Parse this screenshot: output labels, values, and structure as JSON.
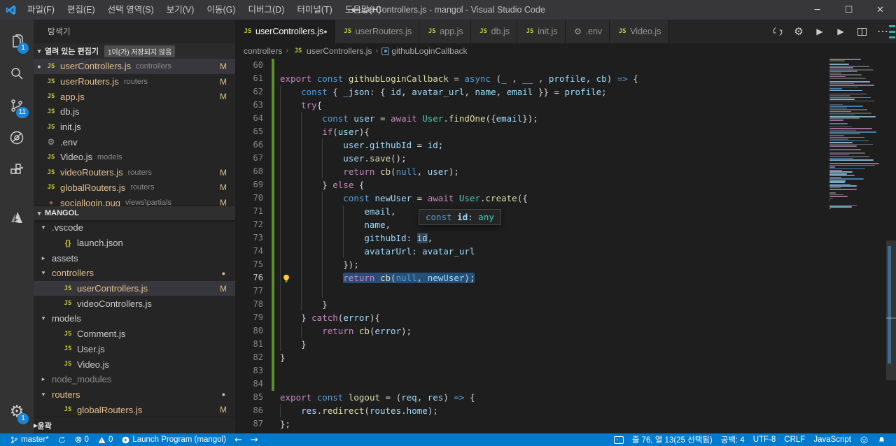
{
  "window": {
    "title": "● userControllers.js - mangol - Visual Studio Code",
    "controls": [
      {
        "name": "minimize",
        "glyph": "─"
      },
      {
        "name": "maximize",
        "glyph": "☐"
      },
      {
        "name": "close",
        "glyph": "✕"
      }
    ]
  },
  "menus": [
    "파일(F)",
    "편집(E)",
    "선택 영역(S)",
    "보기(V)",
    "이동(G)",
    "디버그(D)",
    "터미널(T)",
    "도움말(H)"
  ],
  "activity_bar": {
    "items": [
      {
        "name": "explorer",
        "badge": "1"
      },
      {
        "name": "search",
        "badge": ""
      },
      {
        "name": "source-control",
        "badge": "11"
      },
      {
        "name": "debug",
        "badge": ""
      },
      {
        "name": "extensions",
        "badge": ""
      },
      {
        "name": "azure",
        "badge": "",
        "spaced": true
      }
    ],
    "bottom": {
      "name": "settings-gear",
      "badge": "1"
    }
  },
  "sidebar": {
    "title": "탐색기",
    "open_editors": {
      "label": "열려 있는 편집기",
      "badge": "1이(가) 저장되지 않음",
      "items": [
        {
          "icon": "js",
          "label": "userControllers.js",
          "desc": "controllers",
          "m": true,
          "dirty": true,
          "selected": true,
          "gold": true
        },
        {
          "icon": "js",
          "label": "userRouters.js",
          "desc": "routers",
          "m": true,
          "gold": true
        },
        {
          "icon": "js",
          "label": "app.js",
          "desc": "",
          "m": true,
          "gold": true
        },
        {
          "icon": "js",
          "label": "db.js",
          "desc": "",
          "m": false
        },
        {
          "icon": "js",
          "label": "init.js",
          "desc": "",
          "m": false
        },
        {
          "icon": "gear",
          "label": ".env",
          "desc": "",
          "m": false
        },
        {
          "icon": "js",
          "label": "Video.js",
          "desc": "models",
          "m": false
        },
        {
          "icon": "js",
          "label": "videoRouters.js",
          "desc": "routers",
          "m": true,
          "gold": true
        },
        {
          "icon": "js",
          "label": "globalRouters.js",
          "desc": "routers",
          "m": true,
          "gold": true
        },
        {
          "icon": "pug",
          "label": "sociallogin.pug",
          "desc": "views\\partials",
          "m": true,
          "gold": true
        }
      ]
    },
    "project": {
      "label": "MANGOL",
      "items": [
        {
          "type": "folder",
          "label": ".vscode",
          "expanded": true,
          "level": 0
        },
        {
          "type": "file",
          "icon": "braces",
          "label": "launch.json",
          "level": 1
        },
        {
          "type": "folder",
          "label": "assets",
          "expanded": false,
          "level": 0
        },
        {
          "type": "folder",
          "label": "controllers",
          "expanded": true,
          "level": 0,
          "gold": true,
          "dot": true
        },
        {
          "type": "file",
          "icon": "js",
          "label": "userControllers.js",
          "level": 1,
          "gold": true,
          "m": true,
          "selected": true
        },
        {
          "type": "file",
          "icon": "js",
          "label": "videoControllers.js",
          "level": 1
        },
        {
          "type": "folder",
          "label": "models",
          "expanded": true,
          "level": 0
        },
        {
          "type": "file",
          "icon": "js",
          "label": "Comment.js",
          "level": 1
        },
        {
          "type": "file",
          "icon": "js",
          "label": "User.js",
          "level": 1
        },
        {
          "type": "file",
          "icon": "js",
          "label": "Video.js",
          "level": 1
        },
        {
          "type": "folder",
          "label": "node_modules",
          "expanded": false,
          "level": 0,
          "dim": true
        },
        {
          "type": "folder",
          "label": "routers",
          "expanded": true,
          "level": 0,
          "gold": true,
          "dot": true
        },
        {
          "type": "file",
          "icon": "js",
          "label": "globalRouters.js",
          "level": 1,
          "gold": true,
          "m": true
        }
      ]
    },
    "outline": {
      "label": "윤곽"
    }
  },
  "tabs": [
    {
      "icon": "js",
      "label": "userControllers.js",
      "dirty": true,
      "active": true
    },
    {
      "icon": "js",
      "label": "userRouters.js"
    },
    {
      "icon": "js",
      "label": "app.js"
    },
    {
      "icon": "js",
      "label": "db.js"
    },
    {
      "icon": "js",
      "label": "init.js"
    },
    {
      "icon": "gear",
      "label": ".env"
    },
    {
      "icon": "js",
      "label": "Video.js"
    }
  ],
  "tab_actions": [
    {
      "name": "synchronize-changes"
    },
    {
      "name": "settings-gear"
    },
    {
      "name": "run"
    },
    {
      "name": "run-without-debugging"
    },
    {
      "name": "split-editor"
    },
    {
      "name": "more-actions"
    }
  ],
  "breadcrumb": [
    {
      "label": "controllers"
    },
    {
      "icon": "js",
      "label": "userControllers.js"
    },
    {
      "icon": "method",
      "label": "githubLoginCallback"
    }
  ],
  "hover_popup": {
    "tokens": [
      [
        "b",
        "const"
      ],
      [
        "p",
        " "
      ],
      [
        "v",
        "id"
      ],
      [
        "p",
        ": "
      ],
      [
        "t",
        "any"
      ]
    ]
  },
  "code": {
    "language": "javascript",
    "lightbulb_line": 76,
    "selected_line": 76,
    "git_added_lines": [
      60,
      84
    ],
    "lines": [
      {
        "n": 60,
        "ind": 0,
        "t": []
      },
      {
        "n": 61,
        "ind": 0,
        "t": [
          [
            "k",
            "export"
          ],
          [
            "p",
            " "
          ],
          [
            "b",
            "const"
          ],
          [
            "p",
            " "
          ],
          [
            "f",
            "githubLoginCallback"
          ],
          [
            "p",
            " = "
          ],
          [
            "b",
            "async"
          ],
          [
            "p",
            " ("
          ],
          [
            "v",
            "_"
          ],
          [
            "p",
            " , "
          ],
          [
            "v",
            "__"
          ],
          [
            "p",
            " , "
          ],
          [
            "v",
            "profile"
          ],
          [
            "p",
            ", "
          ],
          [
            "v",
            "cb"
          ],
          [
            "p",
            ") "
          ],
          [
            "b",
            "=>"
          ],
          [
            "p",
            " {"
          ]
        ]
      },
      {
        "n": 62,
        "ind": 4,
        "t": [
          [
            "b",
            "const"
          ],
          [
            "p",
            " { "
          ],
          [
            "v",
            "_json"
          ],
          [
            "p",
            ": { "
          ],
          [
            "v",
            "id"
          ],
          [
            "p",
            ", "
          ],
          [
            "v",
            "avatar_url"
          ],
          [
            "p",
            ", "
          ],
          [
            "v",
            "name"
          ],
          [
            "p",
            ", "
          ],
          [
            "v",
            "email"
          ],
          [
            "p",
            " }} = "
          ],
          [
            "v",
            "profile"
          ],
          [
            "p",
            ";"
          ]
        ]
      },
      {
        "n": 63,
        "ind": 4,
        "t": [
          [
            "k",
            "try"
          ],
          [
            "p",
            "{"
          ]
        ]
      },
      {
        "n": 64,
        "ind": 8,
        "t": [
          [
            "b",
            "const"
          ],
          [
            "p",
            " "
          ],
          [
            "v",
            "user"
          ],
          [
            "p",
            " = "
          ],
          [
            "k",
            "await"
          ],
          [
            "p",
            " "
          ],
          [
            "t",
            "User"
          ],
          [
            "p",
            "."
          ],
          [
            "f",
            "findOne"
          ],
          [
            "p",
            "({"
          ],
          [
            "v",
            "email"
          ],
          [
            "p",
            "});"
          ]
        ]
      },
      {
        "n": 65,
        "ind": 8,
        "t": [
          [
            "k",
            "if"
          ],
          [
            "p",
            "("
          ],
          [
            "v",
            "user"
          ],
          [
            "p",
            "){"
          ]
        ]
      },
      {
        "n": 66,
        "ind": 12,
        "t": [
          [
            "v",
            "user"
          ],
          [
            "p",
            "."
          ],
          [
            "v",
            "githubId"
          ],
          [
            "p",
            " = "
          ],
          [
            "v",
            "id"
          ],
          [
            "p",
            ";"
          ]
        ]
      },
      {
        "n": 67,
        "ind": 12,
        "t": [
          [
            "v",
            "user"
          ],
          [
            "p",
            "."
          ],
          [
            "f",
            "save"
          ],
          [
            "p",
            "();"
          ]
        ]
      },
      {
        "n": 68,
        "ind": 12,
        "t": [
          [
            "k",
            "return"
          ],
          [
            "p",
            " "
          ],
          [
            "f",
            "cb"
          ],
          [
            "p",
            "("
          ],
          [
            "b",
            "null"
          ],
          [
            "p",
            ", "
          ],
          [
            "v",
            "user"
          ],
          [
            "p",
            ");"
          ]
        ]
      },
      {
        "n": 69,
        "ind": 8,
        "t": [
          [
            "p",
            "} "
          ],
          [
            "k",
            "else"
          ],
          [
            "p",
            " {"
          ]
        ]
      },
      {
        "n": 70,
        "ind": 12,
        "t": [
          [
            "b",
            "const"
          ],
          [
            "p",
            " "
          ],
          [
            "v",
            "newUser"
          ],
          [
            "p",
            " = "
          ],
          [
            "k",
            "await"
          ],
          [
            "p",
            " "
          ],
          [
            "t",
            "User"
          ],
          [
            "p",
            "."
          ],
          [
            "f",
            "create"
          ],
          [
            "p",
            "({"
          ]
        ]
      },
      {
        "n": 71,
        "ind": 16,
        "t": [
          [
            "v",
            "email"
          ],
          [
            "p",
            ","
          ]
        ]
      },
      {
        "n": 72,
        "ind": 16,
        "t": [
          [
            "v",
            "name"
          ],
          [
            "p",
            ","
          ]
        ]
      },
      {
        "n": 73,
        "ind": 16,
        "t": [
          [
            "v",
            "githubId"
          ],
          [
            "p",
            ": "
          ],
          [
            "v hl",
            "id"
          ],
          [
            "p",
            ","
          ]
        ]
      },
      {
        "n": 74,
        "ind": 16,
        "t": [
          [
            "v",
            "avatarUrl"
          ],
          [
            "p",
            ": "
          ],
          [
            "v",
            "avatar_url"
          ]
        ]
      },
      {
        "n": 75,
        "ind": 12,
        "t": [
          [
            "p",
            "});"
          ]
        ]
      },
      {
        "n": 76,
        "ind": 12,
        "sel": true,
        "t": [
          [
            "k",
            "return"
          ],
          [
            "p",
            " "
          ],
          [
            "f",
            "cb"
          ],
          [
            "p",
            "("
          ],
          [
            "b",
            "null"
          ],
          [
            "p",
            ", "
          ],
          [
            "v",
            "newUser"
          ],
          [
            "p",
            ");"
          ]
        ]
      },
      {
        "n": 77,
        "ind": 0,
        "g": 3,
        "t": []
      },
      {
        "n": 78,
        "ind": 8,
        "t": [
          [
            "p",
            "}"
          ]
        ]
      },
      {
        "n": 79,
        "ind": 4,
        "t": [
          [
            "p",
            "} "
          ],
          [
            "k",
            "catch"
          ],
          [
            "p",
            "("
          ],
          [
            "v",
            "error"
          ],
          [
            "p",
            "){"
          ]
        ]
      },
      {
        "n": 80,
        "ind": 8,
        "t": [
          [
            "k",
            "return"
          ],
          [
            "p",
            " "
          ],
          [
            "f",
            "cb"
          ],
          [
            "p",
            "("
          ],
          [
            "v",
            "error"
          ],
          [
            "p",
            ");"
          ]
        ]
      },
      {
        "n": 81,
        "ind": 4,
        "t": [
          [
            "p",
            "}"
          ]
        ]
      },
      {
        "n": 82,
        "ind": 0,
        "t": [
          [
            "p",
            "}"
          ]
        ]
      },
      {
        "n": 83,
        "ind": 0,
        "t": []
      },
      {
        "n": 84,
        "ind": 0,
        "t": []
      },
      {
        "n": 85,
        "ind": 0,
        "t": [
          [
            "k",
            "export"
          ],
          [
            "p",
            " "
          ],
          [
            "b",
            "const"
          ],
          [
            "p",
            " "
          ],
          [
            "f",
            "logout"
          ],
          [
            "p",
            " = ("
          ],
          [
            "v",
            "req"
          ],
          [
            "p",
            ", "
          ],
          [
            "v",
            "res"
          ],
          [
            "p",
            ") "
          ],
          [
            "b",
            "=>"
          ],
          [
            "p",
            " {"
          ]
        ]
      },
      {
        "n": 86,
        "ind": 4,
        "t": [
          [
            "v",
            "res"
          ],
          [
            "p",
            "."
          ],
          [
            "f",
            "redirect"
          ],
          [
            "p",
            "("
          ],
          [
            "v",
            "routes"
          ],
          [
            "p",
            "."
          ],
          [
            "v",
            "home"
          ],
          [
            "p",
            ");"
          ]
        ]
      },
      {
        "n": 87,
        "ind": 0,
        "t": [
          [
            "p",
            "};"
          ]
        ]
      }
    ]
  },
  "status_bar": {
    "left": [
      {
        "name": "git-branch",
        "icon": "branch",
        "label": "master*"
      },
      {
        "name": "synchronize",
        "icon": "sync",
        "label": ""
      },
      {
        "name": "errors",
        "icon": "error",
        "label": "0"
      },
      {
        "name": "warnings",
        "icon": "warning",
        "label": "0"
      },
      {
        "name": "launch-program",
        "icon": "play-circle",
        "label": "Launch Program (mangol)"
      },
      {
        "name": "navigate-back",
        "icon": "arrow-left",
        "label": ""
      },
      {
        "name": "navigate-forward",
        "icon": "arrow-right",
        "label": ""
      }
    ],
    "right": [
      {
        "name": "terminal-status",
        "icon": "terminal",
        "label": ""
      },
      {
        "name": "cursor-position",
        "icon": "",
        "label": "줄 76, 열 13(25 선택됨)"
      },
      {
        "name": "indentation",
        "icon": "",
        "label": "공백: 4"
      },
      {
        "name": "encoding",
        "icon": "",
        "label": "UTF-8"
      },
      {
        "name": "eol",
        "icon": "",
        "label": "CRLF"
      },
      {
        "name": "language-mode",
        "icon": "",
        "label": "JavaScript"
      },
      {
        "name": "feedback",
        "icon": "smiley",
        "label": ""
      },
      {
        "name": "notifications",
        "icon": "bell",
        "label": ""
      }
    ]
  },
  "colors": {
    "status_bar": "#007ACC",
    "git_modified": "#E2C08D",
    "git_added_gutter": "#5a8f29",
    "selection": "#264F78",
    "badge": "#1a85d6",
    "editor_bg": "#1e1e1e",
    "sidebar_bg": "#252526",
    "activity_bg": "#333333"
  }
}
